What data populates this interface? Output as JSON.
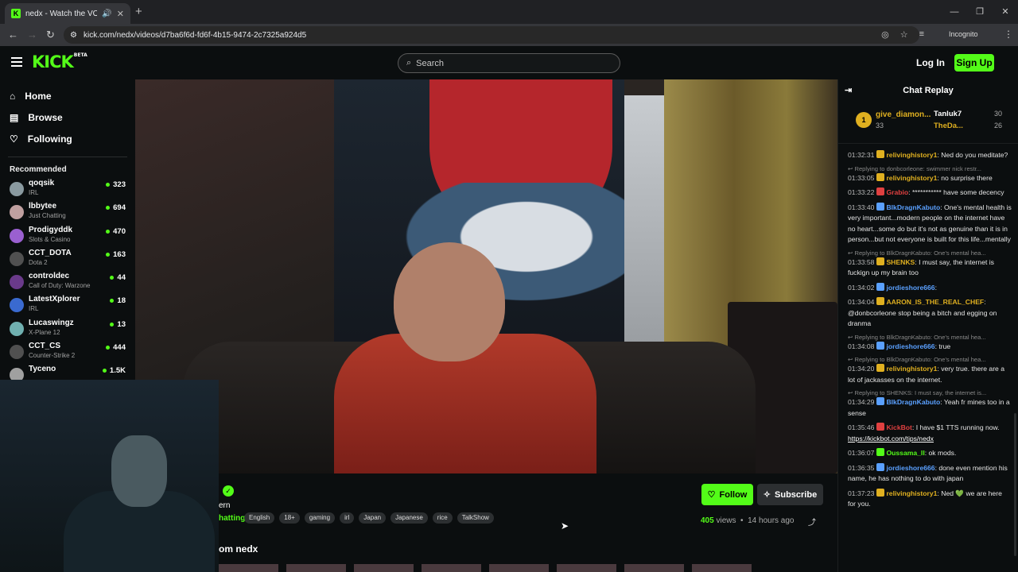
{
  "browser": {
    "tab_title": "nedx - Watch the VOD on",
    "url": "kick.com/nedx/videos/d7ba6f6d-fd6f-4b15-9474-2c7325a924d5",
    "incognito_label": "Incognito"
  },
  "header": {
    "logo": "KICK",
    "logo_badge": "BETA",
    "search_placeholder": "Search",
    "login_label": "Log In",
    "signup_label": "Sign Up"
  },
  "sidebar": {
    "nav": [
      {
        "label": "Home",
        "icon": "home-icon"
      },
      {
        "label": "Browse",
        "icon": "browse-icon"
      },
      {
        "label": "Following",
        "icon": "heart-icon"
      }
    ],
    "recommended_title": "Recommended",
    "channels": [
      {
        "name": "qoqsik",
        "category": "IRL",
        "viewers": "323",
        "color": "#8a9aa0"
      },
      {
        "name": "lbbytee",
        "category": "Just Chatting",
        "viewers": "694",
        "color": "#c0a0a0"
      },
      {
        "name": "Prodigyddk",
        "category": "Slots & Casino",
        "viewers": "470",
        "color": "#9a60d0"
      },
      {
        "name": "CCT_DOTA",
        "category": "Dota 2",
        "viewers": "163",
        "color": "#505050"
      },
      {
        "name": "controldec",
        "category": "Call of Duty: Warzone",
        "viewers": "44",
        "color": "#6a3a8a"
      },
      {
        "name": "LatestXplorer",
        "category": "IRL",
        "viewers": "18",
        "color": "#3a6ad0"
      },
      {
        "name": "Lucaswingz",
        "category": "X-Plane 12",
        "viewers": "13",
        "color": "#70b0b0"
      },
      {
        "name": "CCT_CS",
        "category": "Counter-Strike 2",
        "viewers": "444",
        "color": "#505050"
      },
      {
        "name": "Tyceno",
        "category": "",
        "viewers": "1.5K",
        "color": "#a0a0a0"
      }
    ]
  },
  "video_info": {
    "channel_fragment": "ern",
    "category_fragment": "hatting",
    "tags": [
      "English",
      "18+",
      "gaming",
      "irl",
      "Japan",
      "Japanese",
      "rice",
      "TalkShow"
    ],
    "follow_label": "Follow",
    "subscribe_label": "Subscribe",
    "views": "405",
    "views_suffix": "views",
    "age": "14 hours ago",
    "more_from": "om nedx"
  },
  "chat": {
    "title": "Chat Replay",
    "top_gifters": [
      {
        "name": "give_diamon...",
        "count": "33",
        "rank": "1"
      },
      {
        "name": "Tanluk7",
        "count": "30"
      },
      {
        "name": "TheDa...",
        "count": "26"
      }
    ],
    "messages": [
      {
        "reply": "",
        "time": "01:32:31",
        "user": "relivinghistory1",
        "color": "#e0b020",
        "text": "Ned do you meditate?"
      },
      {
        "reply": "Replying to donbcorleone: swimmer nick restr...",
        "time": "01:33:05",
        "user": "relivinghistory1",
        "color": "#e0b020",
        "text": "no surprise there"
      },
      {
        "reply": "",
        "time": "01:33:22",
        "user": "Grabio",
        "color": "#e04040",
        "text": "*********** have some decency"
      },
      {
        "reply": "",
        "time": "01:33:40",
        "user": "BlkDragnKabuto",
        "color": "#5aa0ff",
        "text": "One's mental health is very important...modern people on the internet have no heart...some do but it's not as genuine than it is in person...but not everyone is built for this life...mentally"
      },
      {
        "reply": "Replying to BlkDragnKabuto: One's mental hea...",
        "time": "01:33:58",
        "user": "SHENKS",
        "color": "#e0b020",
        "text": "I must say, the internet is fuckign up my brain too"
      },
      {
        "reply": "",
        "time": "01:34:02",
        "user": "jordieshore666",
        "color": "#5aa0ff",
        "text": ""
      },
      {
        "reply": "",
        "time": "01:34:04",
        "user": "AARON_IS_THE_REAL_CHEF",
        "color": "#e0b020",
        "text": "@donbcorleone stop being a bitch and egging on dranma"
      },
      {
        "reply": "Replying to BlkDragnKabuto: One's mental hea...",
        "time": "01:34:08",
        "user": "jordieshore666",
        "color": "#5aa0ff",
        "text": "true"
      },
      {
        "reply": "Replying to BlkDragnKabuto: One's mental hea...",
        "time": "01:34:20",
        "user": "relivinghistory1",
        "color": "#e0b020",
        "text": "very true. there are a lot of jackasses on the internet."
      },
      {
        "reply": "Replying to SHENKS: I must say, the internet is...",
        "time": "01:34:29",
        "user": "BlkDragnKabuto",
        "color": "#5aa0ff",
        "text": "Yeah fr mines too in a sense"
      },
      {
        "reply": "",
        "time": "01:35:46",
        "user": "KickBot",
        "color": "#e04040",
        "text": "I have $1 TTS running now. ",
        "link": "https://kickbot.com/tips/nedx"
      },
      {
        "reply": "",
        "time": "01:36:07",
        "user": "Oussama_II",
        "color": "#53fc18",
        "text": "ok mods."
      },
      {
        "reply": "",
        "time": "01:36:35",
        "user": "jordieshore666",
        "color": "#5aa0ff",
        "text": "done even mention his name, he has nothing to do with japan"
      },
      {
        "reply": "",
        "time": "01:37:23",
        "user": "relivinghistory1",
        "color": "#e0b020",
        "text": "Ned 💚 we are here for you."
      }
    ]
  }
}
